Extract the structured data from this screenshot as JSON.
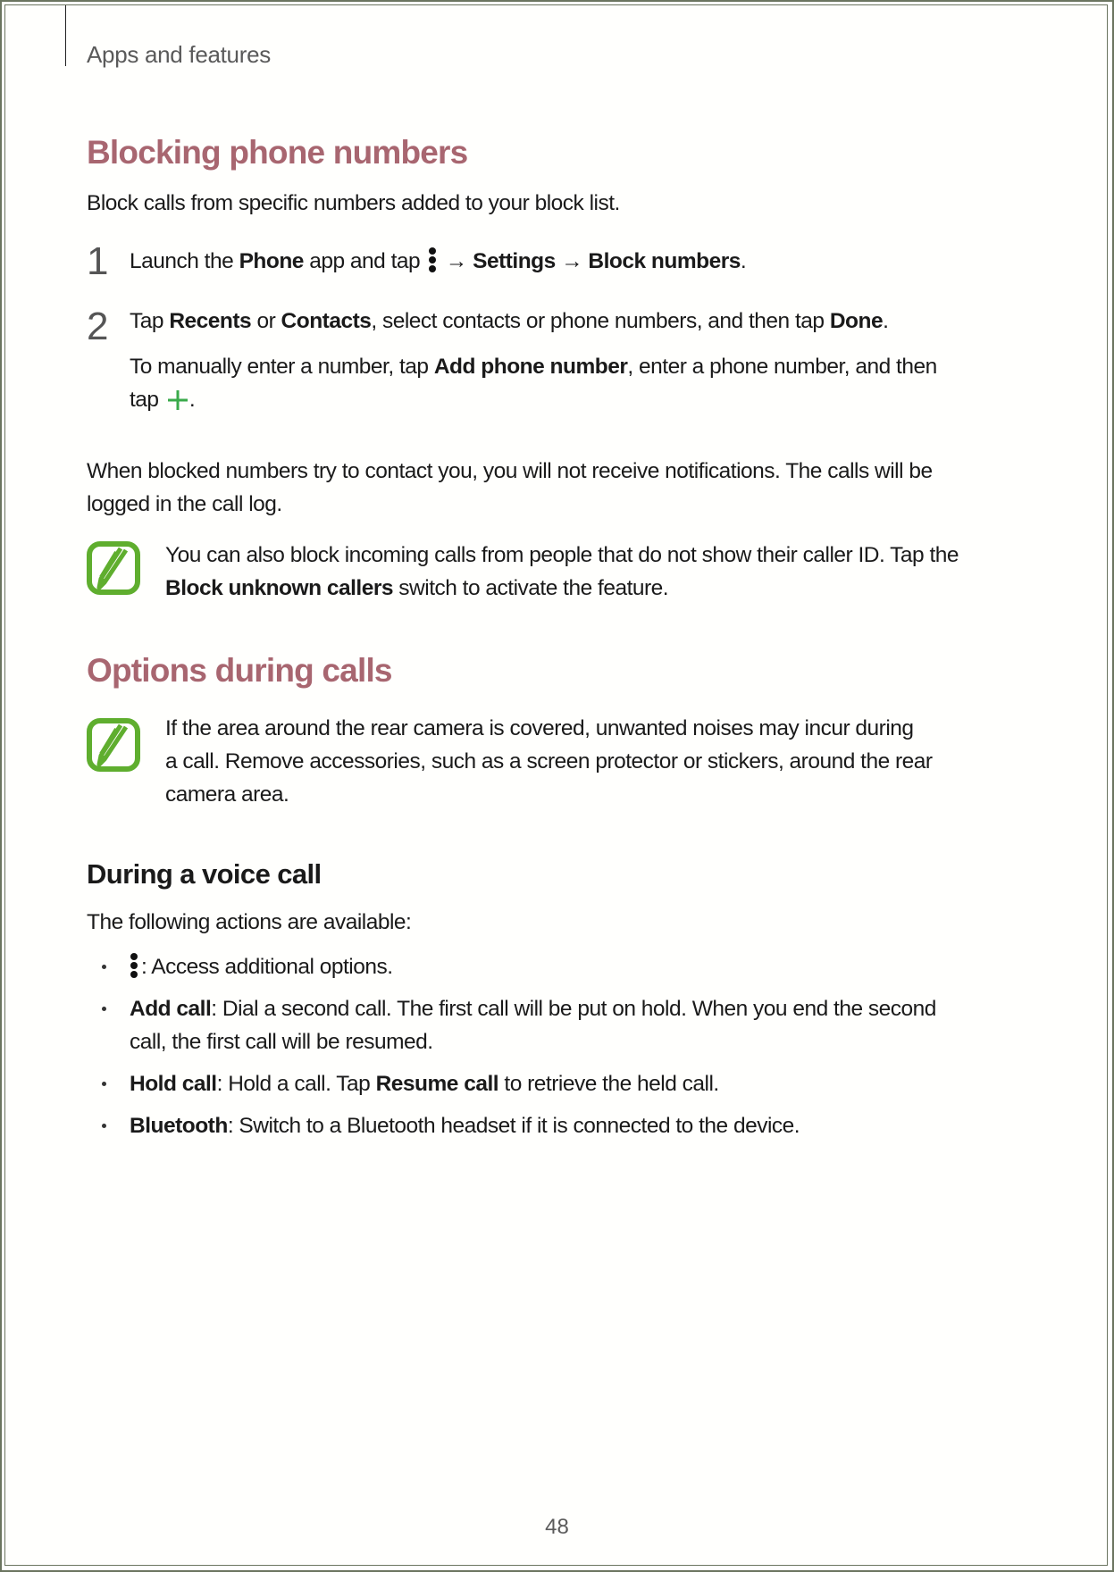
{
  "header": {
    "title": "Apps and features"
  },
  "sections": {
    "blocking": {
      "title": "Blocking phone numbers",
      "intro": "Block calls from specific numbers added to your block list.",
      "step1": {
        "number": "1",
        "text_1": "Launch the ",
        "bold_1": "Phone",
        "text_2": " app and tap ",
        "icon": "more-options-icon",
        "arrow_1": " → ",
        "bold_2": "Settings",
        "arrow_2": " → ",
        "bold_3": "Block numbers",
        "text_3": "."
      },
      "step2": {
        "number": "2",
        "text_1": "Tap ",
        "bold_1": "Recents",
        "text_2": " or ",
        "bold_2": "Contacts",
        "text_3": ", select contacts or phone numbers, and then tap ",
        "bold_3": "Done",
        "text_4": ".",
        "sub_text_1": "To manually enter a number, tap ",
        "sub_bold_1": "Add phone number",
        "sub_text_2": ", enter a phone number, and then",
        "sub_text_3": "tap ",
        "sub_icon": "add-icon",
        "sub_text_4": "."
      },
      "note_para_1": "When blocked numbers try to contact you, you will not receive notifications. The calls will be",
      "note_para_2": "logged in the call log.",
      "tip": {
        "icon": "note-pencil-icon",
        "text_1": "You can also block incoming calls from people that do not show their caller ID. Tap the",
        "bold_1": "Block unknown callers",
        "text_2": " switch to activate the feature."
      }
    },
    "options": {
      "title": "Options during calls",
      "tip": {
        "icon": "note-pencil-icon",
        "line_1": "If the area around the rear camera is covered, unwanted noises may incur during",
        "line_2": "a call. Remove accessories, such as a screen protector or stickers, around the rear",
        "line_3": "camera area."
      }
    },
    "voice_call": {
      "title": "During a voice call",
      "intro": "The following actions are available:",
      "bullets": [
        {
          "icon": "more-options-icon",
          "text": ": Access additional options."
        },
        {
          "bold": "Add call",
          "text_1": ": Dial a second call. The first call will be put on hold. When you end the second",
          "text_2": "call, the first call will be resumed."
        },
        {
          "bold": "Hold call",
          "text_1": ": Hold a call. Tap ",
          "bold_2": "Resume call",
          "text_2": " to retrieve the held call."
        },
        {
          "bold": "Bluetooth",
          "text_1": ": Switch to a Bluetooth headset if it is connected to the device."
        }
      ]
    }
  },
  "footer": {
    "page_number": "48"
  },
  "colors": {
    "section_heading": "#a86670",
    "icon_green": "#5fae2e",
    "plus_green": "#3aaa4a",
    "frame": "#6b7560"
  }
}
